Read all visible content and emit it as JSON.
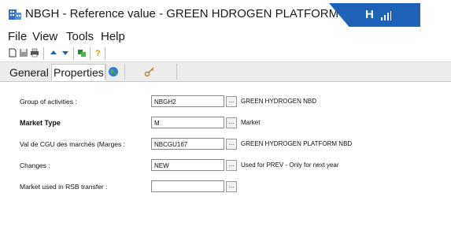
{
  "window": {
    "title": "NBGH - Reference value - GREEN HDROGEN PLATFORM NBD",
    "brand_colors": {
      "accent": "#1f63b8"
    }
  },
  "menu": [
    "File",
    "View",
    "Tools",
    "Help"
  ],
  "toolbar": {
    "icons": [
      "new-document-icon",
      "save-icon",
      "print-icon",
      "arrow-up-icon",
      "arrow-down-icon",
      "refresh-icon",
      "help-icon"
    ]
  },
  "tabs": [
    {
      "label": "General",
      "active": false
    },
    {
      "label": "Properties",
      "active": true
    }
  ],
  "form": {
    "rows": [
      {
        "label": "Group of activities :",
        "value": "NBGH2",
        "desc": "GREEN HYDROGEN NBD",
        "bold": false
      },
      {
        "label": "Market Type",
        "value": "M",
        "desc": "Market",
        "bold": true
      },
      {
        "label": "Val de CGU des marchés (Marges :",
        "value": "NBCGU167",
        "desc": "GREEN HYDROGEN PLATFORM NBD",
        "bold": false
      },
      {
        "label": "Changes :",
        "value": "NEW",
        "desc": "Used for PREV - Only for next year",
        "bold": false
      },
      {
        "label": "Market used in RSB transfer :",
        "value": "",
        "desc": "",
        "bold": false
      }
    ],
    "lookup_button_label": "..."
  }
}
